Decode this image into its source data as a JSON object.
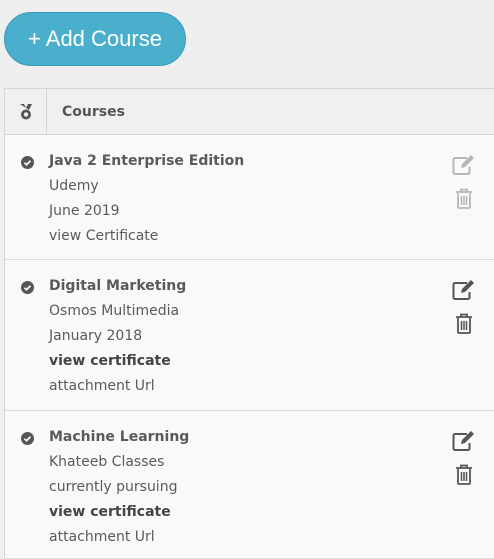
{
  "add_button": "+ Add Course",
  "table": {
    "header": "Courses",
    "header_icon": "medal-icon"
  },
  "courses": [
    {
      "title": "Java 2 Enterprise Edition",
      "lines": [
        {
          "text": "Udemy",
          "bold": false
        },
        {
          "text": "June 2019",
          "bold": false
        },
        {
          "text": "view Certificate",
          "bold": false
        }
      ],
      "actions_dimmed": true
    },
    {
      "title": "Digital Marketing",
      "lines": [
        {
          "text": "Osmos Multimedia",
          "bold": false
        },
        {
          "text": "January 2018",
          "bold": false
        },
        {
          "text": "view certificate",
          "bold": true
        },
        {
          "text": "attachment Url",
          "bold": false
        }
      ],
      "actions_dimmed": false
    },
    {
      "title": "Machine Learning",
      "lines": [
        {
          "text": "Khateeb Classes",
          "bold": false
        },
        {
          "text": "currently pursuing",
          "bold": false
        },
        {
          "text": "view certificate",
          "bold": true
        },
        {
          "text": "attachment Url",
          "bold": false
        }
      ],
      "actions_dimmed": false
    }
  ],
  "colors": {
    "accent": "#4aafcd",
    "text": "#5a5a5a"
  }
}
